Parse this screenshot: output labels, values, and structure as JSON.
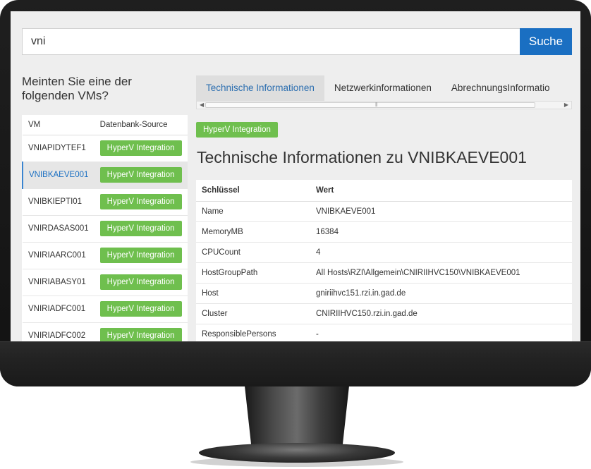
{
  "search": {
    "value": "vni",
    "button_label": "Suche"
  },
  "suggestions": {
    "title": "Meinten Sie eine der folgenden VMs?",
    "headers": {
      "vm": "VM",
      "source": "Datenbank-Source"
    },
    "rows": [
      {
        "vm": "VNIAPIDYTEF1",
        "source": "HyperV Integration",
        "active": false
      },
      {
        "vm": "VNIBKAEVE001",
        "source": "HyperV Integration",
        "active": true
      },
      {
        "vm": "VNIBKIEPTI01",
        "source": "HyperV Integration",
        "active": false
      },
      {
        "vm": "VNIRDASAS001",
        "source": "HyperV Integration",
        "active": false
      },
      {
        "vm": "VNIRIAARC001",
        "source": "HyperV Integration",
        "active": false
      },
      {
        "vm": "VNIRIABASY01",
        "source": "HyperV Integration",
        "active": false
      },
      {
        "vm": "VNIRIADFC001",
        "source": "HyperV Integration",
        "active": false
      },
      {
        "vm": "VNIRIADFC002",
        "source": "HyperV Integration",
        "active": false
      }
    ]
  },
  "tabs": [
    {
      "label": "Technische Informationen",
      "active": true
    },
    {
      "label": "Netzwerkinformationen",
      "active": false
    },
    {
      "label": "AbrechnungsInformatio",
      "active": false
    }
  ],
  "details": {
    "source_badge": "HyperV Integration",
    "title": "Technische Informationen zu VNIBKAEVE001",
    "headers": {
      "key": "Schlüssel",
      "value": "Wert"
    },
    "rows": [
      {
        "key": "Name",
        "value": "VNIBKAEVE001"
      },
      {
        "key": "MemoryMB",
        "value": "16384"
      },
      {
        "key": "CPUCount",
        "value": "4"
      },
      {
        "key": "HostGroupPath",
        "value": "All Hosts\\RZI\\Allgemein\\CNIRIIHVC150\\VNIBKAEVE001"
      },
      {
        "key": "Host",
        "value": "gniriihvc151.rzi.in.gad.de"
      },
      {
        "key": "Cluster",
        "value": "CNIRIIHVC150.rzi.in.gad.de"
      },
      {
        "key": "ResponsiblePersons",
        "value": "-"
      }
    ]
  },
  "colors": {
    "primary": "#1a6fc2",
    "badge_green": "#6fbf4e",
    "active_tab_text": "#2d6fb0"
  }
}
